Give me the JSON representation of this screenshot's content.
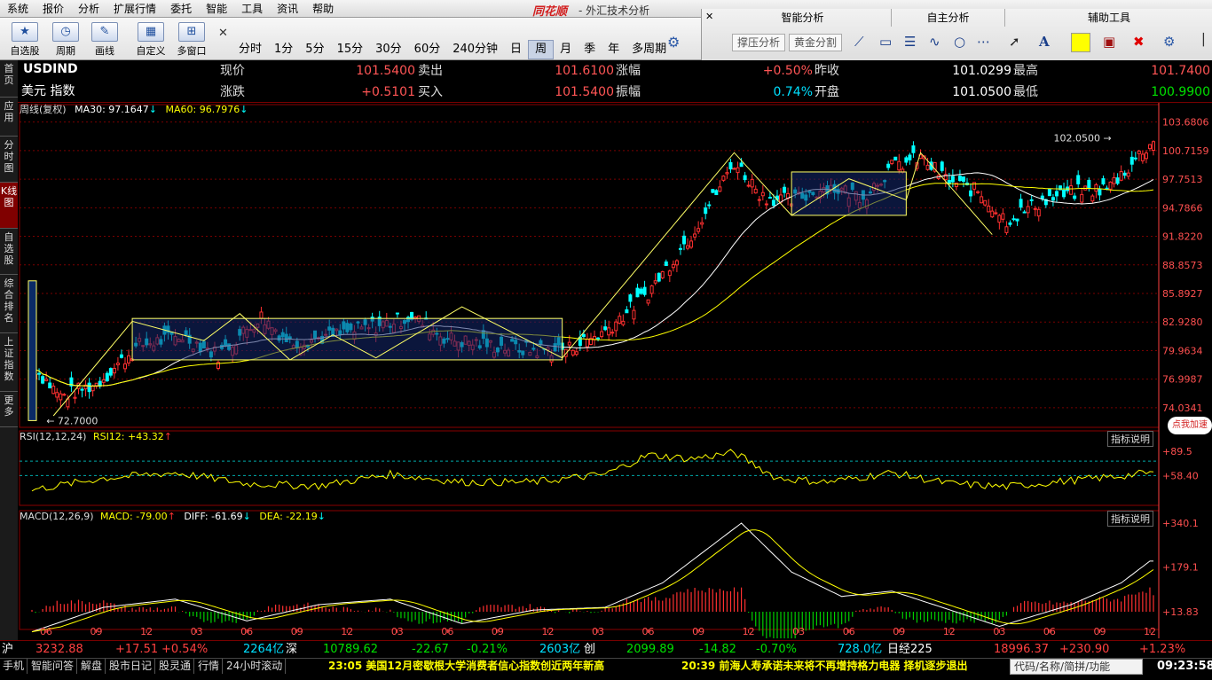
{
  "app": {
    "brand": "同花顺",
    "window_title": "- 外汇技术分析"
  },
  "menu": [
    "系统",
    "报价",
    "分析",
    "扩展行情",
    "委托",
    "智能",
    "工具",
    "资讯",
    "帮助"
  ],
  "toolbar": {
    "buttons": [
      {
        "label": "自选股"
      },
      {
        "label": "周期"
      },
      {
        "label": "画线"
      },
      {
        "label": "自定义"
      },
      {
        "label": "多窗口"
      }
    ]
  },
  "periods": [
    "分时",
    "1分",
    "5分",
    "15分",
    "30分",
    "60分",
    "240分钟",
    "日",
    "周",
    "月",
    "季",
    "年",
    "多周期"
  ],
  "active_period": "周",
  "right_panel": {
    "sections": [
      "智能分析",
      "自主分析",
      "辅助工具"
    ],
    "buttons": [
      "撑压分析",
      "黄金分割"
    ]
  },
  "sidebar": [
    "首页",
    "应用",
    "分时图",
    "K线图",
    "自选股",
    "综合排名",
    "上证指数",
    "更多"
  ],
  "quote": {
    "symbol": "USDIND",
    "name": "美元 指数",
    "row1": [
      {
        "label": "现价",
        "value": "101.5400"
      },
      {
        "label": "卖出",
        "value": "101.6100"
      },
      {
        "label": "涨幅",
        "value": "+0.50%"
      },
      {
        "label": "昨收",
        "value": "101.0299"
      },
      {
        "label": "最高",
        "value": "101.7400"
      }
    ],
    "row2": [
      {
        "label": "涨跌",
        "value": "+0.5101"
      },
      {
        "label": "买入",
        "value": "101.5400"
      },
      {
        "label": "振幅",
        "value": "0.74%"
      },
      {
        "label": "开盘",
        "value": "101.0500"
      },
      {
        "label": "最低",
        "value": "100.9900"
      }
    ]
  },
  "main_legend": {
    "title": "周线(复权)",
    "ma30": "MA30: 97.1647",
    "ma60": "MA60: 96.7976"
  },
  "rsi_legend": {
    "title": "RSI(12,12,24)",
    "rsi12": "RSI12: +43.32"
  },
  "macd_legend": {
    "title": "MACD(12,26,9)",
    "macd": "MACD: -79.00",
    "diff": "DIFF: -61.69",
    "dea": "DEA: -22.19"
  },
  "indicator_help": "指标说明",
  "badge": "点我加速",
  "colors": {
    "up": "#ff3030",
    "down": "#00ffff",
    "ma30": "#ffffff",
    "ma60": "#ffff00",
    "grid": "#7a0000",
    "axis": "#ff4040"
  },
  "chart_data": {
    "type": "candlestick",
    "price_axis": [
      "103.6806",
      "100.7159",
      "97.7513",
      "94.7866",
      "91.8220",
      "88.8573",
      "85.8927",
      "82.9280",
      "79.9634",
      "76.9987",
      "74.0341"
    ],
    "ylim": [
      72.0,
      104.2
    ],
    "max_label": "102.0500",
    "min_label": "72.7000",
    "rsi_axis": [
      "+89.5",
      "+58.40"
    ],
    "macd_axis": [
      "+340.1",
      "+179.1",
      "+13.83"
    ],
    "x_ticks": [
      "06",
      "09",
      "12",
      "03",
      "06",
      "09",
      "12",
      "03",
      "06",
      "09",
      "12",
      "03",
      "06",
      "09",
      "12",
      "03",
      "06",
      "09",
      "12",
      "03",
      "06",
      "09",
      "12"
    ],
    "price_anchors": [
      [
        0,
        78.5
      ],
      [
        8,
        75.2
      ],
      [
        18,
        76.5
      ],
      [
        30,
        80.5
      ],
      [
        42,
        81.5
      ],
      [
        52,
        79.5
      ],
      [
        64,
        83.5
      ],
      [
        72,
        80.8
      ],
      [
        84,
        81.5
      ],
      [
        96,
        82.5
      ],
      [
        106,
        83.5
      ],
      [
        116,
        81.2
      ],
      [
        128,
        80.5
      ],
      [
        140,
        80.0
      ],
      [
        150,
        80.2
      ],
      [
        160,
        82.0
      ],
      [
        172,
        86.0
      ],
      [
        184,
        92.0
      ],
      [
        196,
        99.5
      ],
      [
        204,
        96.0
      ],
      [
        212,
        95.5
      ],
      [
        222,
        97.0
      ],
      [
        232,
        96.0
      ],
      [
        240,
        99.0
      ],
      [
        248,
        100.0
      ],
      [
        256,
        97.5
      ],
      [
        264,
        96.5
      ],
      [
        272,
        93.5
      ],
      [
        282,
        95.5
      ],
      [
        292,
        96.5
      ],
      [
        300,
        96.8
      ],
      [
        306,
        99.0
      ],
      [
        312,
        101.5
      ]
    ],
    "rsi_anchors": [
      [
        0,
        40
      ],
      [
        20,
        55
      ],
      [
        40,
        62
      ],
      [
        60,
        48
      ],
      [
        80,
        45
      ],
      [
        100,
        60
      ],
      [
        120,
        50
      ],
      [
        140,
        50
      ],
      [
        160,
        60
      ],
      [
        172,
        85
      ],
      [
        184,
        80
      ],
      [
        196,
        88
      ],
      [
        208,
        55
      ],
      [
        222,
        50
      ],
      [
        240,
        62
      ],
      [
        256,
        48
      ],
      [
        272,
        44
      ],
      [
        290,
        52
      ],
      [
        300,
        56
      ],
      [
        312,
        62
      ]
    ],
    "macd_anchors": [
      [
        0,
        -60
      ],
      [
        20,
        30
      ],
      [
        40,
        60
      ],
      [
        60,
        -20
      ],
      [
        80,
        40
      ],
      [
        100,
        60
      ],
      [
        120,
        -30
      ],
      [
        140,
        20
      ],
      [
        160,
        30
      ],
      [
        176,
        120
      ],
      [
        190,
        260
      ],
      [
        198,
        340
      ],
      [
        212,
        160
      ],
      [
        226,
        70
      ],
      [
        240,
        90
      ],
      [
        254,
        30
      ],
      [
        270,
        -40
      ],
      [
        290,
        40
      ],
      [
        304,
        120
      ],
      [
        312,
        200
      ]
    ]
  },
  "ticker": {
    "sh_label": "沪",
    "sh_index": "3232.88",
    "sh_change": "+17.51",
    "sh_pct": "+0.54%",
    "sh_vol": "2264亿",
    "sz_label": "深",
    "sz_index": "10789.62",
    "sz_change": "-22.67",
    "sz_pct": "-0.21%",
    "sz_vol": "2603亿",
    "cy_label": "创",
    "cy_index": "2099.89",
    "cy_change": "-14.82",
    "cy_pct": "-0.70%",
    "cy_vol": "728.0亿",
    "rj_label": "日经225",
    "rj_index": "18996.37",
    "rj_change": "+230.90",
    "rj_pct": "+1.23%"
  },
  "status": {
    "tabs": [
      "手机",
      "智能问答",
      "解盘",
      "股市日记",
      "股灵通",
      "行情",
      "24小时滚动"
    ],
    "news1": "23:05 美国12月密歇根大学消费者信心指数创近两年新高",
    "news2": "20:39 前海人寿承诺未来将不再增持格力电器 择机逐步退出",
    "search_placeholder": "代码/名称/简拼/功能",
    "clock": "09:23:58"
  }
}
